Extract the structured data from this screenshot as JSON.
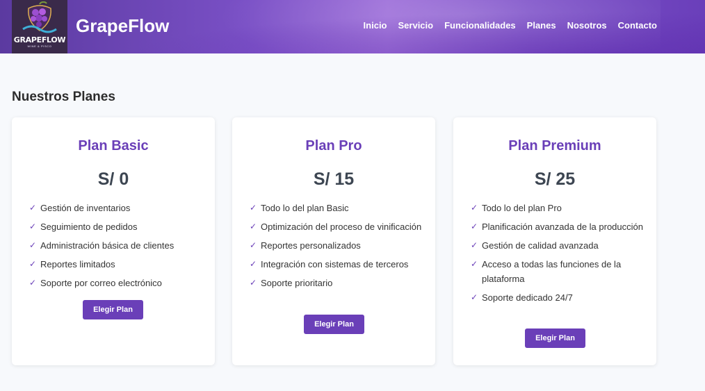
{
  "logo": {
    "name": "GRAPEFLOW",
    "sub": "WINE & PISCO"
  },
  "brand": "GrapeFlow",
  "nav": [
    "Inicio",
    "Servicio",
    "Funcionalidades",
    "Planes",
    "Nosotros",
    "Contacto"
  ],
  "section_title": "Nuestros Planes",
  "plans": [
    {
      "title": "Plan Basic",
      "price": "S/ 0",
      "features": [
        "Gestión de inventarios",
        "Seguimiento de pedidos",
        "Administración básica de clientes",
        "Reportes limitados",
        "Soporte por correo electrónico"
      ],
      "button": "Elegir Plan"
    },
    {
      "title": "Plan Pro",
      "price": "S/ 15",
      "features": [
        "Todo lo del plan Basic",
        "Optimización del proceso de vinificación",
        "Reportes personalizados",
        "Integración con sistemas de terceros",
        "Soporte prioritario"
      ],
      "button": "Elegir Plan"
    },
    {
      "title": "Plan Premium",
      "price": "S/ 25",
      "features": [
        "Todo lo del plan Pro",
        "Planificación avanzada de la producción",
        "Gestión de calidad avanzada",
        "Acceso a todas las funciones de la plataforma",
        "Soporte dedicado 24/7"
      ],
      "button": "Elegir Plan"
    }
  ],
  "check_glyph": "✓",
  "colors": {
    "accent": "#6a3fb8",
    "price": "#3d4652",
    "header_start": "#5b3aa0",
    "header_end": "#6a3fba"
  }
}
